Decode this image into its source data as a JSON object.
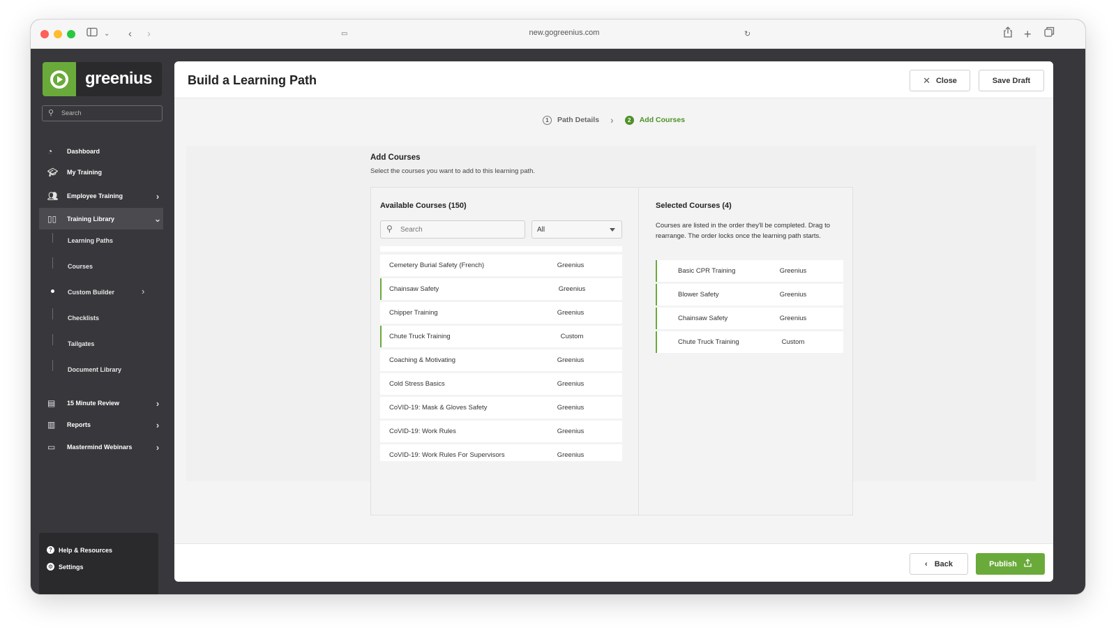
{
  "browser": {
    "url": "new.gogreenius.com",
    "icons": [
      "sidebar-toggle-icon",
      "chevron-left-icon",
      "chevron-right-icon",
      "share-icon",
      "plus-icon",
      "tabs-icon"
    ]
  },
  "sidebar": {
    "brand": "greenius",
    "search_placeholder": "Search",
    "items": [
      {
        "label": "Dashboard",
        "icon": "dashboard-icon"
      },
      {
        "label": "My Training",
        "icon": "graduation-cap-icon"
      },
      {
        "label": "Employee Training",
        "icon": "users-icon"
      },
      {
        "label": "Training Library",
        "icon": "book-icon"
      }
    ],
    "sub_items": [
      {
        "label": "Learning Paths"
      },
      {
        "label": "Courses"
      },
      {
        "label": "Custom Builder"
      },
      {
        "label": "Checklists"
      },
      {
        "label": "Tailgates"
      },
      {
        "label": "Document Library"
      }
    ],
    "lower_items": [
      {
        "label": "15 Minute Review",
        "icon": "document-icon"
      },
      {
        "label": "Reports",
        "icon": "report-icon"
      },
      {
        "label": "Mastermind Webinars",
        "icon": "video-icon"
      }
    ],
    "help": "Help & Resources",
    "settings": "Settings"
  },
  "header": {
    "title": "Build a Learning Path",
    "close_label": "Close",
    "save_label": "Save Draft"
  },
  "stepper": {
    "steps": [
      {
        "num": "1",
        "label": "Path Details",
        "state": "done"
      },
      {
        "num": "2",
        "label": "Add Courses",
        "state": "current"
      }
    ]
  },
  "section": {
    "title": "Add Courses",
    "subtitle": "Select the courses you want to add to this learning path."
  },
  "available": {
    "title": "Available Courses (150)",
    "search_placeholder": "Search",
    "filter_value": "All",
    "rows": [
      {
        "name": "Cemetery Burial Safety (French)",
        "source": "Greenius",
        "selected": false
      },
      {
        "name": "Chainsaw Safety",
        "source": "Greenius",
        "selected": true
      },
      {
        "name": "Chipper Training",
        "source": "Greenius",
        "selected": false
      },
      {
        "name": "Chute Truck Training",
        "source": "Custom",
        "selected": true
      },
      {
        "name": "Coaching & Motivating",
        "source": "Greenius",
        "selected": false
      },
      {
        "name": "Cold Stress Basics",
        "source": "Greenius",
        "selected": false
      },
      {
        "name": "CoVID-19: Mask & Gloves Safety",
        "source": "Greenius",
        "selected": false
      },
      {
        "name": "CoVID-19: Work Rules",
        "source": "Greenius",
        "selected": false
      },
      {
        "name": "CoVID-19: Work Rules For Supervisors",
        "source": "Greenius",
        "selected": false
      }
    ]
  },
  "selected": {
    "title": "Selected Courses (4)",
    "description": "Courses are listed in the order they'll be completed. Drag to rearrange. The order locks once the learning path starts.",
    "rows": [
      {
        "name": "Basic CPR Training",
        "source": "Greenius"
      },
      {
        "name": "Blower Safety",
        "source": "Greenius"
      },
      {
        "name": "Chainsaw Safety",
        "source": "Greenius"
      },
      {
        "name": "Chute Truck Training",
        "source": "Custom"
      }
    ]
  },
  "footer": {
    "back_label": "Back",
    "publish_label": "Publish"
  },
  "colors": {
    "accent": "#6aaa3a",
    "sidebar_bg": "#38383c"
  }
}
